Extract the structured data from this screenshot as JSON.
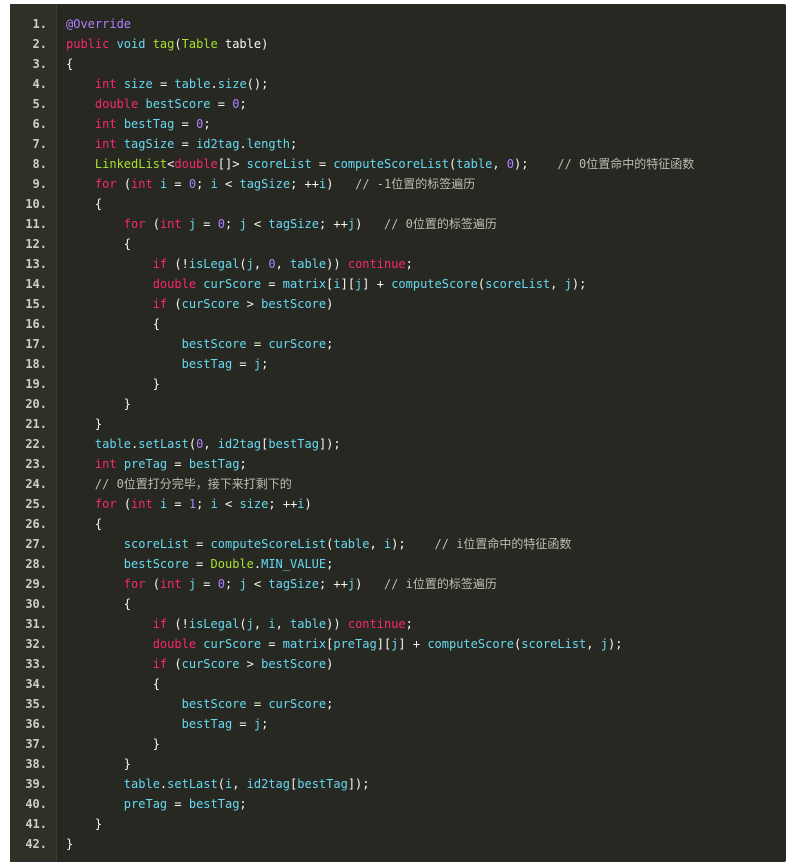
{
  "editor": {
    "lines": [
      {
        "n": "1.",
        "t": [
          [
            "an",
            "@Override"
          ]
        ]
      },
      {
        "n": "2.",
        "t": [
          [
            "kw",
            "public "
          ],
          [
            "ty",
            "void "
          ],
          [
            "fn",
            "tag"
          ],
          [
            "pl",
            "("
          ],
          [
            "fn",
            "Table"
          ],
          [
            "pl",
            " table)"
          ]
        ]
      },
      {
        "n": "3.",
        "t": [
          [
            "pl",
            "{"
          ]
        ]
      },
      {
        "n": "4.",
        "t": [
          [
            "pl",
            "    "
          ],
          [
            "kw",
            "int "
          ],
          [
            "ty",
            "size"
          ],
          [
            "pl",
            " = "
          ],
          [
            "ty",
            "table"
          ],
          [
            "pl",
            "."
          ],
          [
            "ty",
            "size"
          ],
          [
            "pl",
            "();"
          ]
        ]
      },
      {
        "n": "5.",
        "t": [
          [
            "pl",
            "    "
          ],
          [
            "kw",
            "double "
          ],
          [
            "ty",
            "bestScore"
          ],
          [
            "pl",
            " = "
          ],
          [
            "num",
            "0"
          ],
          [
            "pl",
            ";"
          ]
        ]
      },
      {
        "n": "6.",
        "t": [
          [
            "pl",
            "    "
          ],
          [
            "kw",
            "int "
          ],
          [
            "ty",
            "bestTag"
          ],
          [
            "pl",
            " = "
          ],
          [
            "num",
            "0"
          ],
          [
            "pl",
            ";"
          ]
        ]
      },
      {
        "n": "7.",
        "t": [
          [
            "pl",
            "    "
          ],
          [
            "kw",
            "int "
          ],
          [
            "ty",
            "tagSize"
          ],
          [
            "pl",
            " = "
          ],
          [
            "ty",
            "id2tag"
          ],
          [
            "pl",
            "."
          ],
          [
            "ty",
            "length"
          ],
          [
            "pl",
            ";"
          ]
        ]
      },
      {
        "n": "8.",
        "t": [
          [
            "pl",
            "    "
          ],
          [
            "fn",
            "LinkedList"
          ],
          [
            "pl",
            "<"
          ],
          [
            "kw",
            "double"
          ],
          [
            "pl",
            "[]> "
          ],
          [
            "ty",
            "scoreList"
          ],
          [
            "pl",
            " = "
          ],
          [
            "ty",
            "computeScoreList"
          ],
          [
            "pl",
            "("
          ],
          [
            "ty",
            "table"
          ],
          [
            "pl",
            ", "
          ],
          [
            "num",
            "0"
          ],
          [
            "pl",
            ");    "
          ],
          [
            "cm",
            "// 0位置命中的特征函数"
          ]
        ]
      },
      {
        "n": "9.",
        "t": [
          [
            "pl",
            "    "
          ],
          [
            "kw",
            "for "
          ],
          [
            "pl",
            "("
          ],
          [
            "kw",
            "int "
          ],
          [
            "ty",
            "i"
          ],
          [
            "pl",
            " = "
          ],
          [
            "num",
            "0"
          ],
          [
            "pl",
            "; "
          ],
          [
            "ty",
            "i"
          ],
          [
            "pl",
            " < "
          ],
          [
            "ty",
            "tagSize"
          ],
          [
            "pl",
            "; ++"
          ],
          [
            "ty",
            "i"
          ],
          [
            "pl",
            ")   "
          ],
          [
            "cm",
            "// -1位置的标签遍历"
          ]
        ]
      },
      {
        "n": "10.",
        "t": [
          [
            "pl",
            "    {"
          ]
        ]
      },
      {
        "n": "11.",
        "t": [
          [
            "pl",
            "        "
          ],
          [
            "kw",
            "for "
          ],
          [
            "pl",
            "("
          ],
          [
            "kw",
            "int "
          ],
          [
            "ty",
            "j"
          ],
          [
            "pl",
            " = "
          ],
          [
            "num",
            "0"
          ],
          [
            "pl",
            "; "
          ],
          [
            "ty",
            "j"
          ],
          [
            "pl",
            " < "
          ],
          [
            "ty",
            "tagSize"
          ],
          [
            "pl",
            "; ++"
          ],
          [
            "ty",
            "j"
          ],
          [
            "pl",
            ")   "
          ],
          [
            "cm",
            "// 0位置的标签遍历"
          ]
        ]
      },
      {
        "n": "12.",
        "t": [
          [
            "pl",
            "        {"
          ]
        ]
      },
      {
        "n": "13.",
        "t": [
          [
            "pl",
            "            "
          ],
          [
            "kw",
            "if "
          ],
          [
            "pl",
            "(!"
          ],
          [
            "ty",
            "isLegal"
          ],
          [
            "pl",
            "("
          ],
          [
            "ty",
            "j"
          ],
          [
            "pl",
            ", "
          ],
          [
            "num",
            "0"
          ],
          [
            "pl",
            ", "
          ],
          [
            "ty",
            "table"
          ],
          [
            "pl",
            ")) "
          ],
          [
            "kw",
            "continue"
          ],
          [
            "pl",
            ";"
          ]
        ]
      },
      {
        "n": "14.",
        "t": [
          [
            "pl",
            "            "
          ],
          [
            "kw",
            "double "
          ],
          [
            "ty",
            "curScore"
          ],
          [
            "pl",
            " = "
          ],
          [
            "ty",
            "matrix"
          ],
          [
            "pl",
            "["
          ],
          [
            "ty",
            "i"
          ],
          [
            "pl",
            "]["
          ],
          [
            "ty",
            "j"
          ],
          [
            "pl",
            "] + "
          ],
          [
            "ty",
            "computeScore"
          ],
          [
            "pl",
            "("
          ],
          [
            "ty",
            "scoreList"
          ],
          [
            "pl",
            ", "
          ],
          [
            "ty",
            "j"
          ],
          [
            "pl",
            ");"
          ]
        ]
      },
      {
        "n": "15.",
        "t": [
          [
            "pl",
            "            "
          ],
          [
            "kw",
            "if "
          ],
          [
            "pl",
            "("
          ],
          [
            "ty",
            "curScore"
          ],
          [
            "pl",
            " > "
          ],
          [
            "ty",
            "bestScore"
          ],
          [
            "pl",
            ")"
          ]
        ]
      },
      {
        "n": "16.",
        "t": [
          [
            "pl",
            "            {"
          ]
        ]
      },
      {
        "n": "17.",
        "t": [
          [
            "pl",
            "                "
          ],
          [
            "ty",
            "bestScore"
          ],
          [
            "pl",
            " = "
          ],
          [
            "ty",
            "curScore"
          ],
          [
            "pl",
            ";"
          ]
        ]
      },
      {
        "n": "18.",
        "t": [
          [
            "pl",
            "                "
          ],
          [
            "ty",
            "bestTag"
          ],
          [
            "pl",
            " = "
          ],
          [
            "ty",
            "j"
          ],
          [
            "pl",
            ";"
          ]
        ]
      },
      {
        "n": "19.",
        "t": [
          [
            "pl",
            "            }"
          ]
        ]
      },
      {
        "n": "20.",
        "t": [
          [
            "pl",
            "        }"
          ]
        ]
      },
      {
        "n": "21.",
        "t": [
          [
            "pl",
            "    }"
          ]
        ]
      },
      {
        "n": "22.",
        "t": [
          [
            "pl",
            "    "
          ],
          [
            "ty",
            "table"
          ],
          [
            "pl",
            "."
          ],
          [
            "ty",
            "setLast"
          ],
          [
            "pl",
            "("
          ],
          [
            "num",
            "0"
          ],
          [
            "pl",
            ", "
          ],
          [
            "ty",
            "id2tag"
          ],
          [
            "pl",
            "["
          ],
          [
            "ty",
            "bestTag"
          ],
          [
            "pl",
            "]);"
          ]
        ]
      },
      {
        "n": "23.",
        "t": [
          [
            "pl",
            "    "
          ],
          [
            "kw",
            "int "
          ],
          [
            "ty",
            "preTag"
          ],
          [
            "pl",
            " = "
          ],
          [
            "ty",
            "bestTag"
          ],
          [
            "pl",
            ";"
          ]
        ]
      },
      {
        "n": "24.",
        "t": [
          [
            "pl",
            "    "
          ],
          [
            "cm",
            "// 0位置打分完毕，接下来打剩下的"
          ]
        ]
      },
      {
        "n": "25.",
        "t": [
          [
            "pl",
            "    "
          ],
          [
            "kw",
            "for "
          ],
          [
            "pl",
            "("
          ],
          [
            "kw",
            "int "
          ],
          [
            "ty",
            "i"
          ],
          [
            "pl",
            " = "
          ],
          [
            "num",
            "1"
          ],
          [
            "pl",
            "; "
          ],
          [
            "ty",
            "i"
          ],
          [
            "pl",
            " < "
          ],
          [
            "ty",
            "size"
          ],
          [
            "pl",
            "; ++"
          ],
          [
            "ty",
            "i"
          ],
          [
            "pl",
            ")"
          ]
        ]
      },
      {
        "n": "26.",
        "t": [
          [
            "pl",
            "    {"
          ]
        ]
      },
      {
        "n": "27.",
        "t": [
          [
            "pl",
            "        "
          ],
          [
            "ty",
            "scoreList"
          ],
          [
            "pl",
            " = "
          ],
          [
            "ty",
            "computeScoreList"
          ],
          [
            "pl",
            "("
          ],
          [
            "ty",
            "table"
          ],
          [
            "pl",
            ", "
          ],
          [
            "ty",
            "i"
          ],
          [
            "pl",
            ");    "
          ],
          [
            "cm",
            "// i位置命中的特征函数"
          ]
        ]
      },
      {
        "n": "28.",
        "t": [
          [
            "pl",
            "        "
          ],
          [
            "ty",
            "bestScore"
          ],
          [
            "pl",
            " = "
          ],
          [
            "fn",
            "Double"
          ],
          [
            "pl",
            "."
          ],
          [
            "ty",
            "MIN_VALUE"
          ],
          [
            "pl",
            ";"
          ]
        ]
      },
      {
        "n": "29.",
        "t": [
          [
            "pl",
            "        "
          ],
          [
            "kw",
            "for "
          ],
          [
            "pl",
            "("
          ],
          [
            "kw",
            "int "
          ],
          [
            "ty",
            "j"
          ],
          [
            "pl",
            " = "
          ],
          [
            "num",
            "0"
          ],
          [
            "pl",
            "; "
          ],
          [
            "ty",
            "j"
          ],
          [
            "pl",
            " < "
          ],
          [
            "ty",
            "tagSize"
          ],
          [
            "pl",
            "; ++"
          ],
          [
            "ty",
            "j"
          ],
          [
            "pl",
            ")   "
          ],
          [
            "cm",
            "// i位置的标签遍历"
          ]
        ]
      },
      {
        "n": "30.",
        "t": [
          [
            "pl",
            "        {"
          ]
        ]
      },
      {
        "n": "31.",
        "t": [
          [
            "pl",
            "            "
          ],
          [
            "kw",
            "if "
          ],
          [
            "pl",
            "(!"
          ],
          [
            "ty",
            "isLegal"
          ],
          [
            "pl",
            "("
          ],
          [
            "ty",
            "j"
          ],
          [
            "pl",
            ", "
          ],
          [
            "ty",
            "i"
          ],
          [
            "pl",
            ", "
          ],
          [
            "ty",
            "table"
          ],
          [
            "pl",
            ")) "
          ],
          [
            "kw",
            "continue"
          ],
          [
            "pl",
            ";"
          ]
        ]
      },
      {
        "n": "32.",
        "t": [
          [
            "pl",
            "            "
          ],
          [
            "kw",
            "double "
          ],
          [
            "ty",
            "curScore"
          ],
          [
            "pl",
            " = "
          ],
          [
            "ty",
            "matrix"
          ],
          [
            "pl",
            "["
          ],
          [
            "ty",
            "preTag"
          ],
          [
            "pl",
            "]["
          ],
          [
            "ty",
            "j"
          ],
          [
            "pl",
            "] + "
          ],
          [
            "ty",
            "computeScore"
          ],
          [
            "pl",
            "("
          ],
          [
            "ty",
            "scoreList"
          ],
          [
            "pl",
            ", "
          ],
          [
            "ty",
            "j"
          ],
          [
            "pl",
            ");"
          ]
        ]
      },
      {
        "n": "33.",
        "t": [
          [
            "pl",
            "            "
          ],
          [
            "kw",
            "if "
          ],
          [
            "pl",
            "("
          ],
          [
            "ty",
            "curScore"
          ],
          [
            "pl",
            " > "
          ],
          [
            "ty",
            "bestScore"
          ],
          [
            "pl",
            ")"
          ]
        ]
      },
      {
        "n": "34.",
        "t": [
          [
            "pl",
            "            {"
          ]
        ]
      },
      {
        "n": "35.",
        "t": [
          [
            "pl",
            "                "
          ],
          [
            "ty",
            "bestScore"
          ],
          [
            "pl",
            " = "
          ],
          [
            "ty",
            "curScore"
          ],
          [
            "pl",
            ";"
          ]
        ]
      },
      {
        "n": "36.",
        "t": [
          [
            "pl",
            "                "
          ],
          [
            "ty",
            "bestTag"
          ],
          [
            "pl",
            " = "
          ],
          [
            "ty",
            "j"
          ],
          [
            "pl",
            ";"
          ]
        ]
      },
      {
        "n": "37.",
        "t": [
          [
            "pl",
            "            }"
          ]
        ]
      },
      {
        "n": "38.",
        "t": [
          [
            "pl",
            "        }"
          ]
        ]
      },
      {
        "n": "39.",
        "t": [
          [
            "pl",
            "        "
          ],
          [
            "ty",
            "table"
          ],
          [
            "pl",
            "."
          ],
          [
            "ty",
            "setLast"
          ],
          [
            "pl",
            "("
          ],
          [
            "ty",
            "i"
          ],
          [
            "pl",
            ", "
          ],
          [
            "ty",
            "id2tag"
          ],
          [
            "pl",
            "["
          ],
          [
            "ty",
            "bestTag"
          ],
          [
            "pl",
            "]);"
          ]
        ]
      },
      {
        "n": "40.",
        "t": [
          [
            "pl",
            "        "
          ],
          [
            "ty",
            "preTag"
          ],
          [
            "pl",
            " = "
          ],
          [
            "ty",
            "bestTag"
          ],
          [
            "pl",
            ";"
          ]
        ]
      },
      {
        "n": "41.",
        "t": [
          [
            "pl",
            "    }"
          ]
        ]
      },
      {
        "n": "42.",
        "t": [
          [
            "pl",
            "}"
          ]
        ]
      }
    ]
  }
}
